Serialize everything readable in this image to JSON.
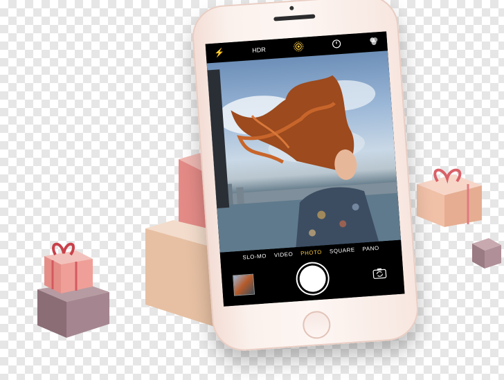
{
  "camera": {
    "flash_icon": "flash-icon",
    "hdr_label": "HDR",
    "live_icon": "live-photo-icon",
    "timer_icon": "timer-icon",
    "filters_icon": "filters-icon",
    "modes": [
      "SLO-MO",
      "VIDEO",
      "PHOTO",
      "SQUARE",
      "PANO"
    ],
    "selected_mode": "PHOTO",
    "switch_camera_icon": "switch-camera-icon"
  },
  "colors": {
    "phone_rose_gold": "#f7e6df",
    "accent_yellow": "#f5c542",
    "gift_pink": "#e89b92",
    "box_tan": "#e9c5ad",
    "box_mauve": "#9a7a83"
  }
}
